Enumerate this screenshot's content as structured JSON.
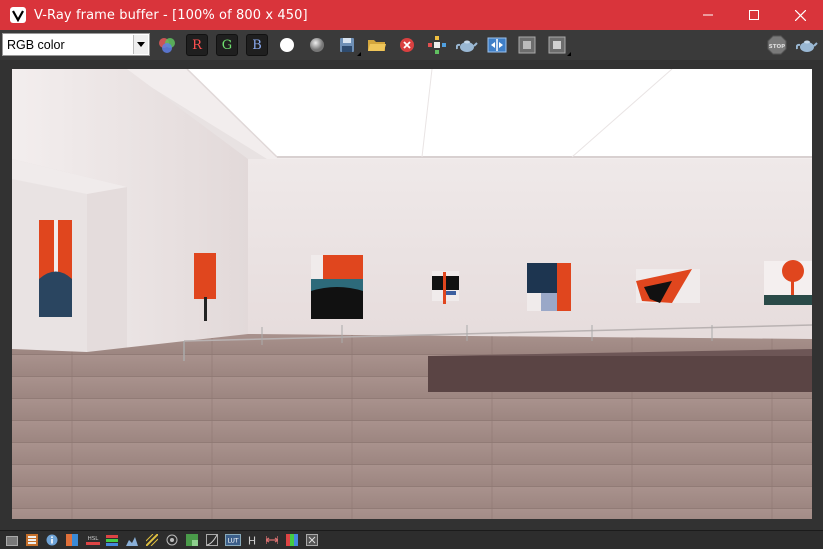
{
  "window": {
    "title": "V-Ray frame buffer - [100% of 800 x 450]",
    "app_icon": "vray-logo-icon",
    "controls": [
      "minimize-icon",
      "maximize-icon",
      "close-icon"
    ]
  },
  "toolbar": {
    "channel_select": {
      "value": "RGB color"
    },
    "channels": {
      "r": "R",
      "g": "G",
      "b": "B"
    },
    "buttons": [
      "color-channels-icon",
      "red-channel",
      "green-channel",
      "blue-channel",
      "white-alpha-icon",
      "mono-icon",
      "save-image-icon",
      "load-image-icon",
      "clear-image-icon",
      "track-mouse-icon",
      "render-teapot-icon",
      "compare-ab-icon",
      "region-icon",
      "region-lock-icon",
      "stop-render-icon",
      "render-last-icon"
    ],
    "stop_label": "STOP"
  },
  "statusbar": {
    "icons": [
      "history-window-icon",
      "render-elements-icon",
      "info-icon",
      "color-correction-icon",
      "hsl-icon",
      "levels-icon",
      "curves-icon",
      "exposure-icon",
      "lens-effects-icon",
      "background-icon",
      "lut-graph-icon",
      "lut-icon",
      "histogram-h-icon",
      "stamp-icon",
      "color-bar-icon",
      "pixel-info-icon"
    ],
    "hsl_label": "HSL",
    "lut_label": "LUT",
    "h_label": "H"
  },
  "colors": {
    "titlebar": "#d9343b",
    "toolbar": "#3a3a3a",
    "viewport": "#323232",
    "accent_orange": "#e0461e"
  }
}
